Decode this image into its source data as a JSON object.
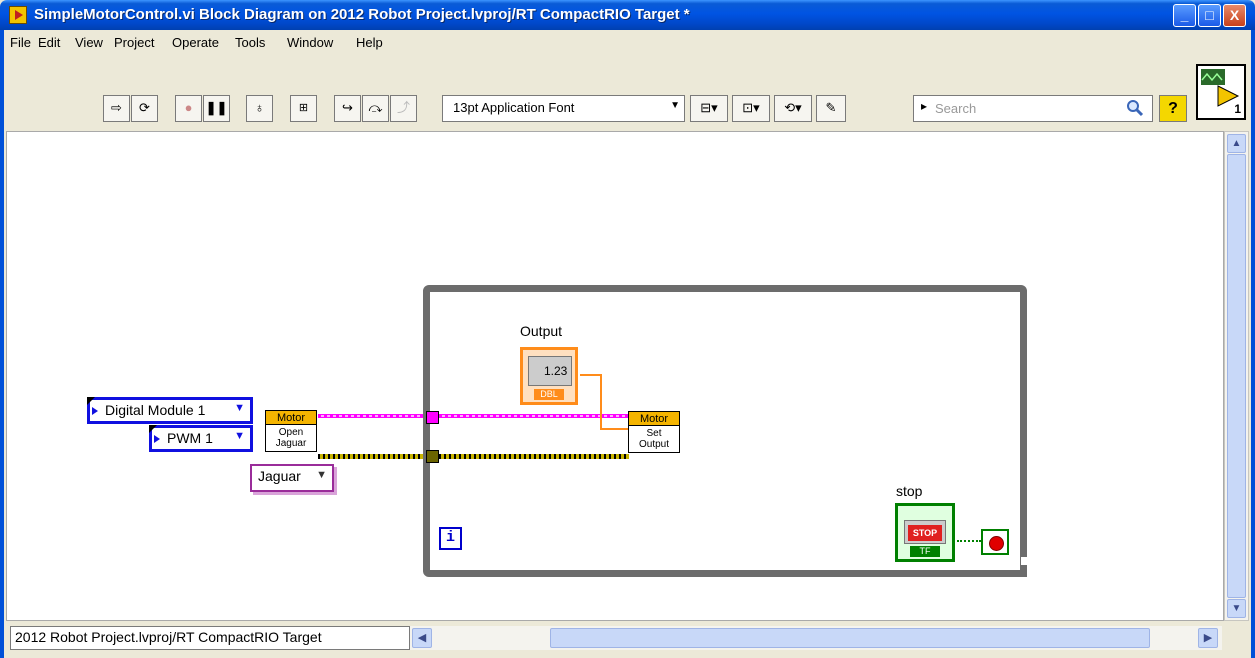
{
  "window": {
    "title": "SimpleMotorControl.vi Block Diagram on 2012 Robot Project.lvproj/RT CompactRIO Target *",
    "min_label": "_",
    "max_label": "□",
    "close_label": "X"
  },
  "menu": [
    "File",
    "Edit",
    "View",
    "Project",
    "Operate",
    "Tools",
    "Window",
    "Help"
  ],
  "toolbar": {
    "font_select": "13pt Application Font",
    "search_placeholder": "Search",
    "help_label": "?"
  },
  "vi_icon_number": "1",
  "diagram": {
    "module_ring": "Digital Module 1",
    "pwm_ring": "PWM 1",
    "jaguar_enum": "Jaguar",
    "open_vi": {
      "header": "Motor",
      "line1": "Open",
      "line2": "Jaguar"
    },
    "set_vi": {
      "header": "Motor",
      "line1": "Set",
      "line2": "Output"
    },
    "output_label": "Output",
    "output_value": "1.23",
    "output_type": "DBL",
    "stop_label": "stop",
    "stop_button": "STOP",
    "stop_type": "TF",
    "iteration": "i"
  },
  "status": {
    "path": "2012 Robot Project.lvproj/RT CompactRIO Target"
  }
}
